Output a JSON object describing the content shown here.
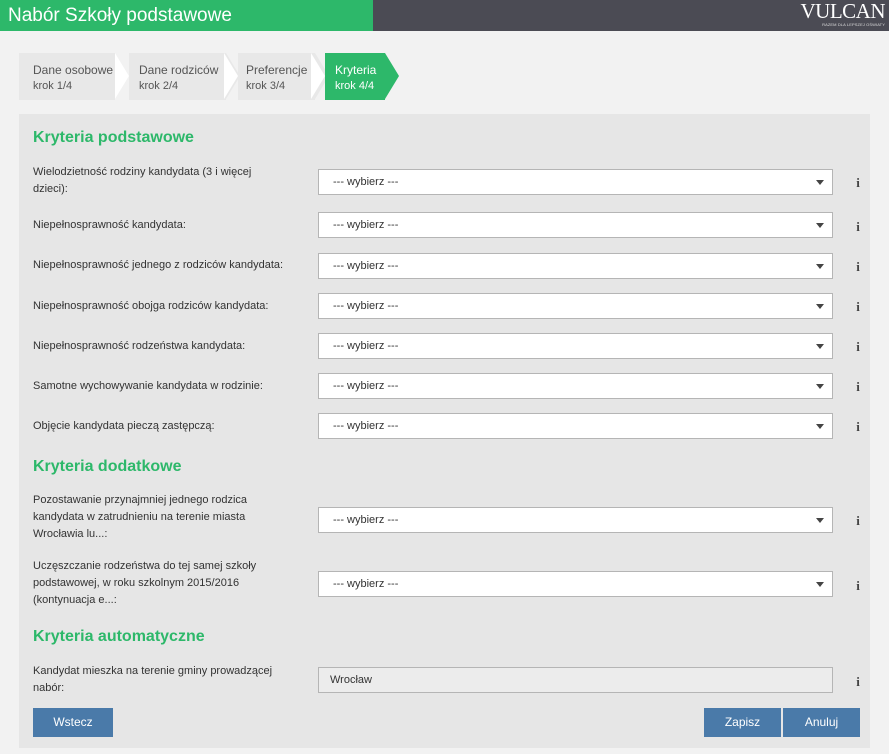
{
  "header": {
    "title": "Nabór Szkoły podstawowe",
    "logo_text": "VULCAN",
    "logo_tagline": "RAZEM DLA LEPSZEJ OŚWIATY"
  },
  "steps": [
    {
      "title": "Dane osobowe",
      "sub": "krok 1/4",
      "active": false
    },
    {
      "title": "Dane rodziców",
      "sub": "krok 2/4",
      "active": false
    },
    {
      "title": "Preferencje",
      "sub": "krok 3/4",
      "active": false
    },
    {
      "title": "Kryteria",
      "sub": "krok 4/4",
      "active": true
    }
  ],
  "sections": {
    "basic": {
      "title": "Kryteria podstawowe",
      "fields": [
        {
          "label": "Wielodzietność rodziny kandydata (3 i więcej dzieci):",
          "value": "--- wybierz ---"
        },
        {
          "label": "Niepełnosprawność kandydata:",
          "value": "--- wybierz ---"
        },
        {
          "label": "Niepełnosprawność jednego z rodziców kandydata:",
          "value": "--- wybierz ---"
        },
        {
          "label": "Niepełnosprawność obojga rodziców kandydata:",
          "value": "--- wybierz ---"
        },
        {
          "label": "Niepełnosprawność rodzeństwa kandydata:",
          "value": "--- wybierz ---"
        },
        {
          "label": "Samotne wychowywanie kandydata w rodzinie:",
          "value": "--- wybierz ---"
        },
        {
          "label": "Objęcie kandydata pieczą zastępczą:",
          "value": "--- wybierz ---"
        }
      ]
    },
    "additional": {
      "title": "Kryteria dodatkowe",
      "fields": [
        {
          "label": "Pozostawanie przynajmniej jednego rodzica kandydata w zatrudnieniu na terenie miasta Wrocławia lu...:",
          "value": "--- wybierz ---"
        },
        {
          "label": "Uczęszczanie rodzeństwa do tej samej szkoły podstawowej, w roku szkolnym 2015/2016 (kontynuacja e...:",
          "value": "--- wybierz ---"
        }
      ]
    },
    "automatic": {
      "title": "Kryteria automatyczne",
      "fields": [
        {
          "label": "Kandydat mieszka na terenie gminy prowadzącej nabór:",
          "value": "Wrocław"
        }
      ]
    }
  },
  "buttons": {
    "back": "Wstecz",
    "save": "Zapisz",
    "cancel": "Anuluj"
  },
  "info_glyph": "i",
  "colors": {
    "accent_green": "#2db86a",
    "header_dark": "#4b4b54",
    "button_blue": "#4a7aa9"
  }
}
